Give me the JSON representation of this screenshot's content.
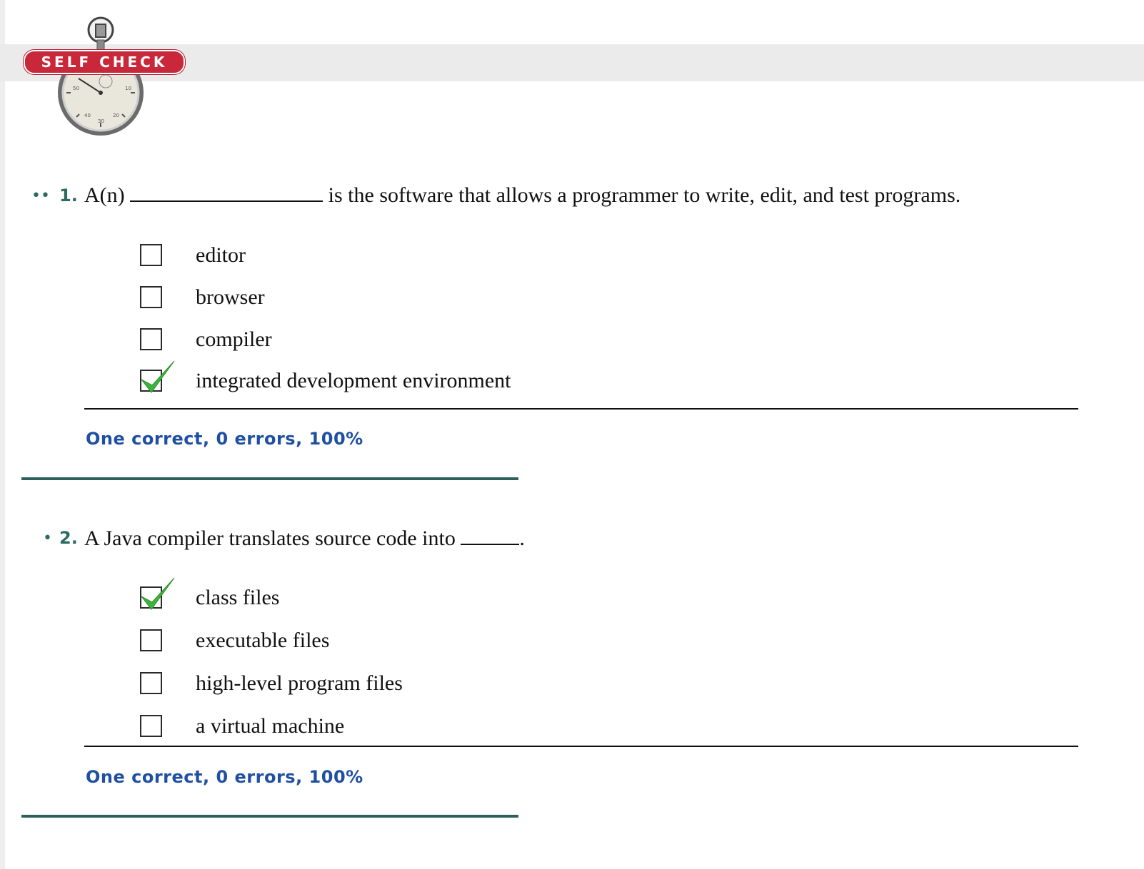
{
  "header": {
    "badge_label": "SELF CHECK",
    "logo_icon": "stopwatch-icon"
  },
  "questions": [
    {
      "dots": "••",
      "number": "1.",
      "text_before": "A(n)",
      "text_after": "is the software that allows a programmer to write, edit, and test programs.",
      "options": [
        {
          "label": "editor",
          "checked": false
        },
        {
          "label": "browser",
          "checked": false
        },
        {
          "label": "compiler",
          "checked": false
        },
        {
          "label": "integrated development environment",
          "checked": true
        }
      ],
      "result": "One correct, 0 errors, 100%"
    },
    {
      "dots": "•",
      "number": "2.",
      "text_before": "A Java compiler translates source code into",
      "text_after": ".",
      "options": [
        {
          "label": "class files",
          "checked": true
        },
        {
          "label": "executable files",
          "checked": false
        },
        {
          "label": "high-level program files",
          "checked": false
        },
        {
          "label": "a virtual machine",
          "checked": false
        }
      ],
      "result": "One correct, 0 errors, 100%"
    }
  ],
  "colors": {
    "badge": "#c8283a",
    "question_number": "#2d6a62",
    "result_text": "#1f4fa3",
    "check_green": "#3cb43c",
    "separator": "#2e5f5c"
  }
}
